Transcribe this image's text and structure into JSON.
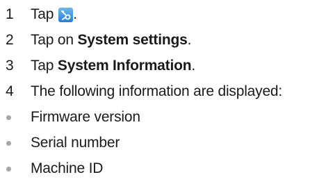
{
  "steps": [
    {
      "number": "1",
      "prefix": "Tap",
      "suffix": "."
    },
    {
      "number": "2",
      "prefix": "Tap on ",
      "bold": "System settings",
      "suffix": "."
    },
    {
      "number": "3",
      "prefix": "Tap ",
      "bold": "System Information",
      "suffix": "."
    },
    {
      "number": "4",
      "text": "The following information are displayed:"
    }
  ],
  "bullets": [
    "Firmware version",
    "Serial number",
    "Machine ID"
  ],
  "icons": {
    "settings": "settings-tools-icon"
  },
  "colors": {
    "icon_bg_top": "#6db7ef",
    "icon_bg_bottom": "#2a7fd0",
    "bullet": "#a6a6a6"
  }
}
